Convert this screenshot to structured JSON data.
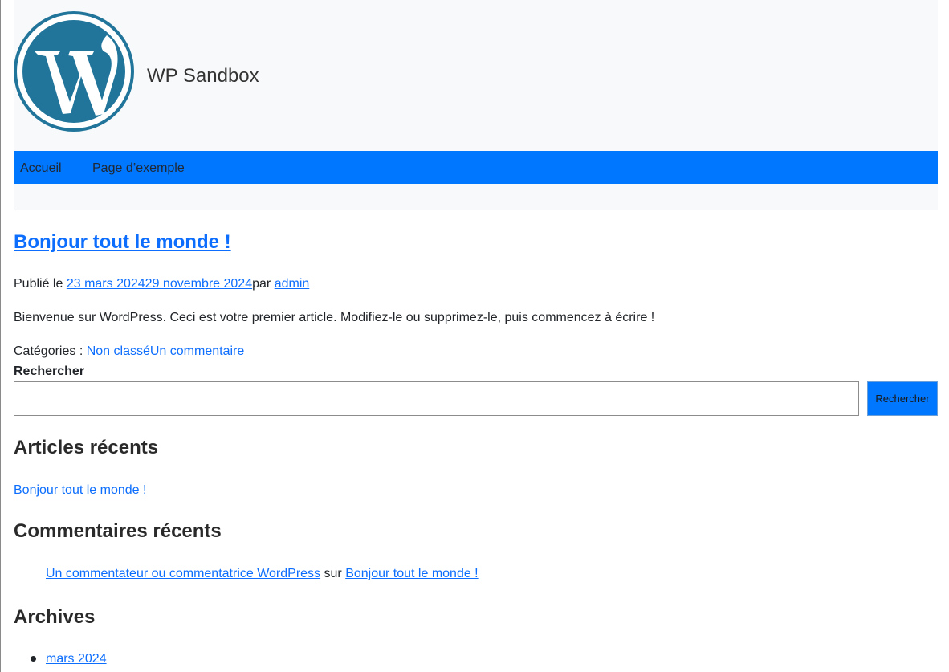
{
  "site": {
    "title": "WP Sandbox",
    "logo_icon": "wordpress-logo-icon"
  },
  "colors": {
    "nav_bg": "#0077ff",
    "link": "#0d6efd",
    "header_bg": "#f8f9fa"
  },
  "nav": {
    "items": [
      {
        "label": "Accueil"
      },
      {
        "label": "Page d’exemple"
      }
    ]
  },
  "post": {
    "title": "Bonjour tout le monde !",
    "meta": {
      "published_prefix": "Publié le ",
      "date_published": "23 mars 2024",
      "date_modified": "29 novembre 2024",
      "by_prefix": "par ",
      "author": "admin"
    },
    "content": "Bienvenue sur WordPress. Ceci est votre premier article. Modifiez-le ou supprimez-le, puis commencez à écrire !",
    "categories_prefix": "Catégories : ",
    "category": "Non classé",
    "comments_link": "Un commentaire"
  },
  "search": {
    "label": "Rechercher",
    "value": "",
    "button_label": "Rechercher"
  },
  "widgets": {
    "recent_posts": {
      "title": "Articles récents",
      "items": [
        {
          "label": "Bonjour tout le monde !"
        }
      ]
    },
    "recent_comments": {
      "title": "Commentaires récents",
      "items": [
        {
          "author": "Un commentateur ou commentatrice WordPress",
          "connector": " sur ",
          "post": "Bonjour tout le monde !"
        }
      ]
    },
    "archives": {
      "title": "Archives",
      "items": [
        {
          "label": "mars 2024"
        }
      ]
    }
  }
}
